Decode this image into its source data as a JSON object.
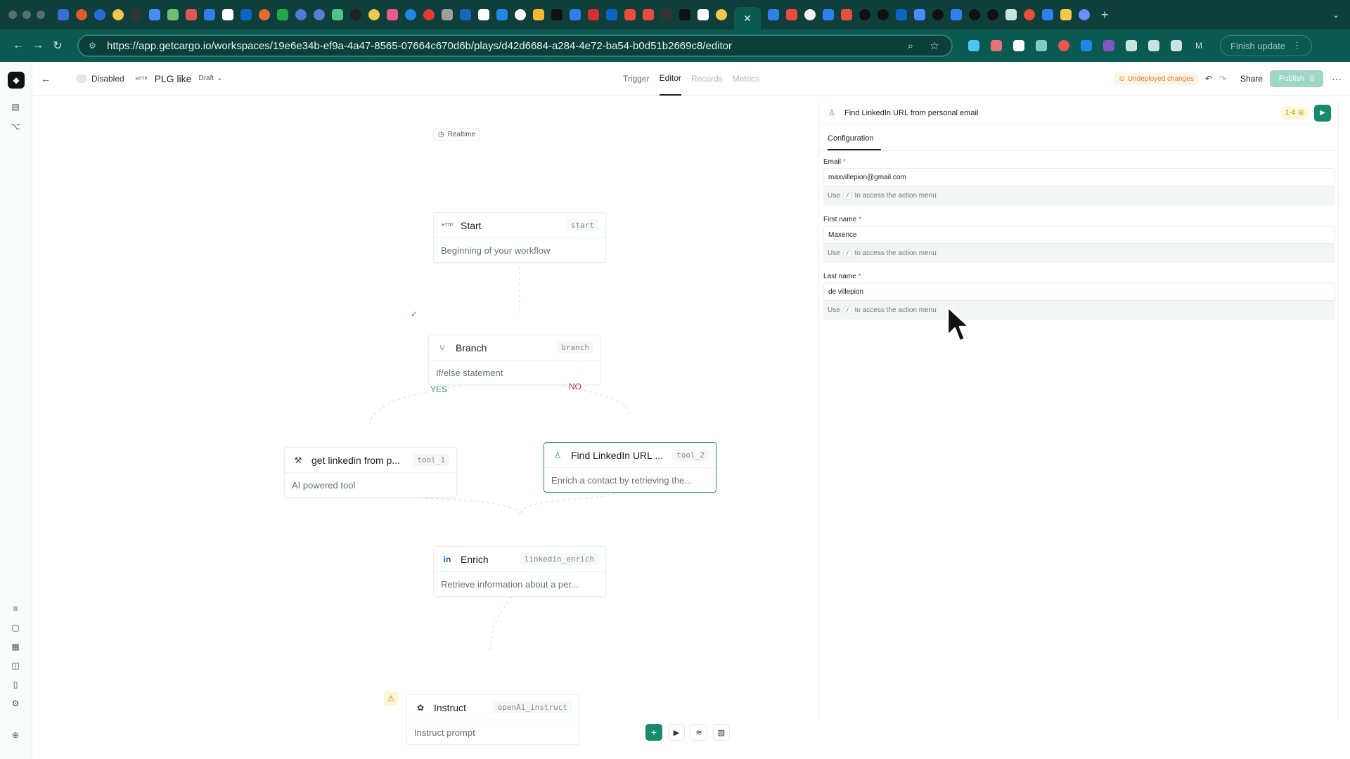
{
  "browser": {
    "url": "https://app.getcargo.io/workspaces/19e6e34b-ef9a-4a47-8565-07664c670d6b/plays/d42d6684-a284-4e72-ba54-b0d51b2669c8/editor",
    "finish_update_label": "Finish update",
    "profile_initial": "M"
  },
  "colors": {
    "accent": "#168a6a",
    "tabbar_bg": "#0e3f3a",
    "toolbar_bg": "#0b5a52",
    "warning": "#d9822b",
    "no_label": "#c0303a",
    "yes_label": "#2f9e7f"
  },
  "header": {
    "status_label": "Disabled",
    "trigger_type": "HTTP",
    "play_name": "PLG like",
    "draft_label": "Draft",
    "tabs": [
      {
        "label": "Trigger"
      },
      {
        "label": "Editor"
      },
      {
        "label": "Records"
      },
      {
        "label": "Metrics"
      }
    ],
    "undeployed_label": "Undeployed changes",
    "share_label": "Share",
    "publish_label": "Publish",
    "publish_count": "0"
  },
  "canvas": {
    "realtime_label": "Realtime",
    "nodes": [
      {
        "name": "Start",
        "code": "start",
        "desc": "Beginning of your workflow",
        "icon": "http-icon"
      },
      {
        "name": "Branch",
        "code": "branch",
        "desc": "If/else statement",
        "icon": "branch-icon"
      },
      {
        "name": "get linkedin from p...",
        "code": "tool_1",
        "desc": "AI powered tool",
        "icon": "tools-icon"
      },
      {
        "name": "Find LinkedIn URL ...",
        "code": "tool_2",
        "desc": "Enrich a contact by retrieving the...",
        "icon": "person-icon"
      },
      {
        "name": "Enrich",
        "code": "linkedin_enrich",
        "desc": "Retrieve information about a per...",
        "icon": "linkedin-icon"
      },
      {
        "name": "Instruct",
        "code": "openAi_instruct",
        "desc": "Instruct prompt",
        "icon": "openai-icon"
      }
    ],
    "yes_label": "YES",
    "no_label": "NO"
  },
  "panel": {
    "title": "Find LinkedIn URL from personal email",
    "credit_label": "1-4",
    "tab_label": "Configuration",
    "fields": [
      {
        "label": "Email",
        "value": "maxvillepion@gmail.com",
        "helper_pre": "Use",
        "helper_key": "/",
        "helper_post": "to access the action menu"
      },
      {
        "label": "First name",
        "value": "Maxence",
        "helper_pre": "Use",
        "helper_key": "/",
        "helper_post": "to access the action menu"
      },
      {
        "label": "Last name",
        "value": "de villepion",
        "helper_pre": "Use",
        "helper_key": "/",
        "helper_post": "to access the action menu"
      }
    ]
  }
}
